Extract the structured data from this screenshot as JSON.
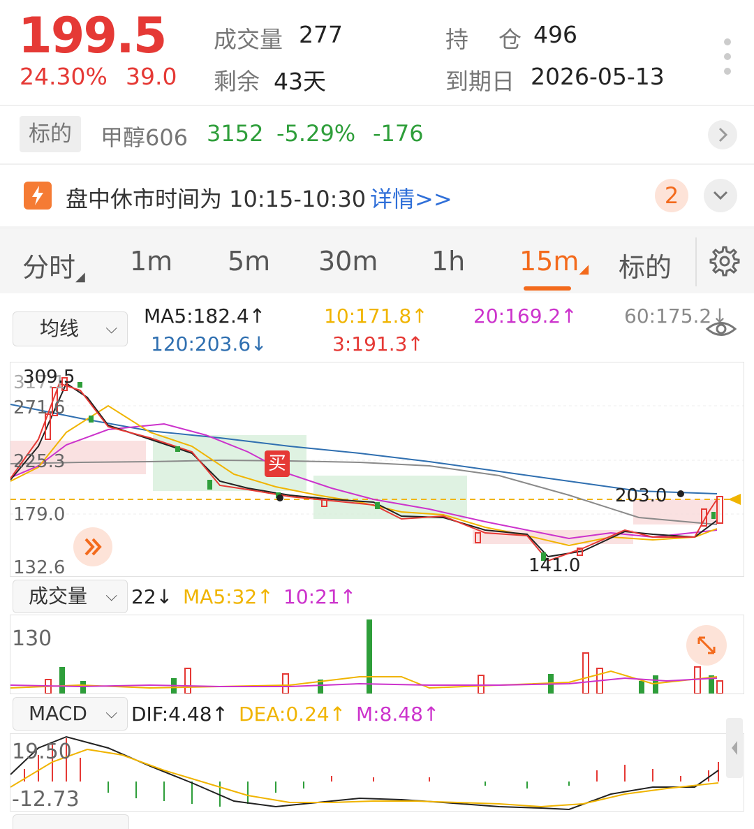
{
  "header": {
    "price": "199.5",
    "change_pct": "24.30%",
    "change_abs": "39.0",
    "volume_label": "成交量",
    "volume_value": "277",
    "remaining_label": "剩余",
    "remaining_value": "43天",
    "oi_label_1": "持",
    "oi_label_2": "仓",
    "oi_value": "496",
    "expiry_label": "到期日",
    "expiry_value": "2026-05-13"
  },
  "underlying": {
    "tag": "标的",
    "name": "甲醇606",
    "price": "3152",
    "change_pct": "-5.29%",
    "change_abs": "-176"
  },
  "notice": {
    "text": "盘中休市时间为 10:15-10:30",
    "link": "详情>>",
    "badge": "2"
  },
  "tabs": [
    "分时",
    "1m",
    "5m",
    "30m",
    "1h",
    "15m",
    "标的"
  ],
  "active_tab": "15m",
  "ma_panel": {
    "selector": "均线",
    "ma5": "MA5:182.4↑",
    "ma10": "10:171.8↑",
    "ma20": "20:169.2↑",
    "ma60": "60:175.2↓",
    "ma120": "120:203.6↓",
    "ma3": "3:191.3↑"
  },
  "price_axis": {
    "top_label": "317.1",
    "l2": "271.6",
    "l3": "225.3",
    "l4": "179.0",
    "bottom_label": "132.6",
    "high_marker": "309.5",
    "low_marker": "141.0",
    "last_marker": "203.0",
    "buy_tag": "买"
  },
  "volume_panel": {
    "selector": "成交量",
    "current": "22↓",
    "ma5": "MA5:32↑",
    "ma10": "10:21↑",
    "axis_max": "130"
  },
  "macd_panel": {
    "selector": "MACD",
    "dif": "DIF:4.48↑",
    "dea": "DEA:0.24↑",
    "m": "M:8.48↑",
    "axis_max": "19.50",
    "axis_min": "-12.73"
  },
  "colors": {
    "up": "#e53935",
    "down": "#2e9e3a",
    "accent": "#f36a1c",
    "ma5": "#222222",
    "ma10": "#f0b400",
    "ma20": "#cc33cc",
    "ma60": "#8a8a8a",
    "ma120": "#2f6fb0",
    "ma3": "#e53935",
    "link": "#2f6fd8"
  },
  "icons": {
    "more": "more-vertical-icon",
    "chevron_right": "chevron-right-icon",
    "lightning": "lightning-icon",
    "collapse": "chevron-down-icon",
    "settings": "gear-icon",
    "eye": "eye-icon",
    "fast_forward": "fast-forward-icon",
    "expand": "expand-icon",
    "side_tab": "chevron-left-icon"
  }
}
